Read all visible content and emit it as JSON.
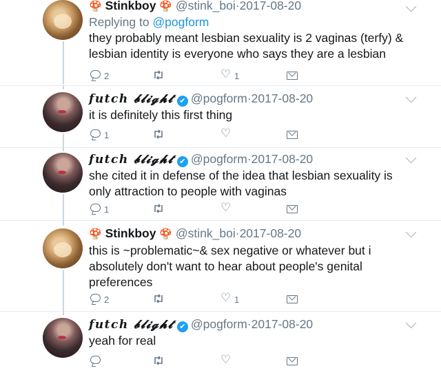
{
  "tweets": [
    {
      "display_name": "Stinkboy",
      "handle": "@stink_boi",
      "sep": "·",
      "date": "2017-08-20",
      "replying_prefix": "Replying to ",
      "replying_to": "@pogform",
      "text": "they probably meant lesbian sexuality is 2 vaginas (terfy) & lesbian identity is everyone who says they are a lesbian",
      "reply_count": "2",
      "retweet_count": "",
      "like_count": "1"
    },
    {
      "display_name": "𝒇𝒖𝒕𝒄𝒉 𝓫𝓵𝓲𝓰𝓱𝓽",
      "handle": "@pogform",
      "sep": "·",
      "date": "2017-08-20",
      "text": "it is definitely this first thing",
      "reply_count": "1",
      "retweet_count": "",
      "like_count": ""
    },
    {
      "display_name": "𝒇𝒖𝒕𝒄𝒉 𝓫𝓵𝓲𝓰𝓱𝓽",
      "handle": "@pogform",
      "sep": "·",
      "date": "2017-08-20",
      "text": "she cited it in defense of the idea that lesbian sexuality is only attraction to people with vaginas",
      "reply_count": "1",
      "retweet_count": "",
      "like_count": ""
    },
    {
      "display_name": "Stinkboy",
      "handle": "@stink_boi",
      "sep": "·",
      "date": "2017-08-20",
      "text": "this is ~problematic~& sex negative or whatever but i absolutely don't want to hear about people's genital preferences",
      "reply_count": "2",
      "retweet_count": "",
      "like_count": "1"
    },
    {
      "display_name": "𝒇𝒖𝒕𝒄𝒉 𝓫𝓵𝓲𝓰𝓱𝓽",
      "handle": "@pogform",
      "sep": "·",
      "date": "2017-08-20",
      "text": "yeah for real",
      "reply_count": "",
      "retweet_count": "",
      "like_count": ""
    }
  ],
  "icons": {
    "mushroom": "🍄",
    "verified": "✔",
    "reply": "reply-icon",
    "retweet": "retweet-icon",
    "like": "heart-icon",
    "dm": "mail-icon",
    "more": "chevron-down-icon"
  },
  "colors": {
    "link": "#1b95e0",
    "verified": "#1da1f2",
    "muted": "#657786",
    "thread_line": "#ccd6dd"
  }
}
